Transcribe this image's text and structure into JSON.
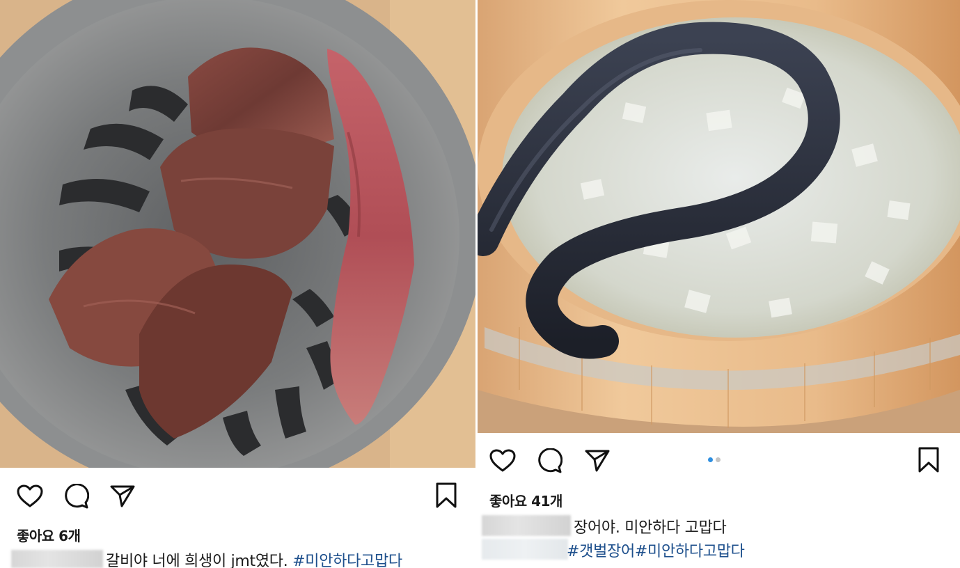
{
  "left_post": {
    "photo_icon": "grilled-galbi-photo",
    "likes_text": "좋아요 6개",
    "caption_text": "갈비야 너에 희생이 jmt였다. ",
    "hashtags": "#미안하다고맙다",
    "icons": [
      "heart-icon",
      "comment-icon",
      "share-icon",
      "bookmark-icon"
    ]
  },
  "right_post": {
    "photo_icon": "eel-bucket-photo",
    "likes_text": "좋아요 41개",
    "caption_text": "장어야. 미안하다 고맙다",
    "hashtags": "#갯벌장어#미안하다고맙다",
    "carousel": {
      "total": 2,
      "active": 1
    },
    "icons": [
      "heart-icon",
      "comment-icon",
      "share-icon",
      "bookmark-icon"
    ]
  },
  "colors": {
    "hashtag": "#1d4f8c",
    "carousel_active": "#2f8fe0",
    "carousel_inactive": "#c4c4c4"
  }
}
